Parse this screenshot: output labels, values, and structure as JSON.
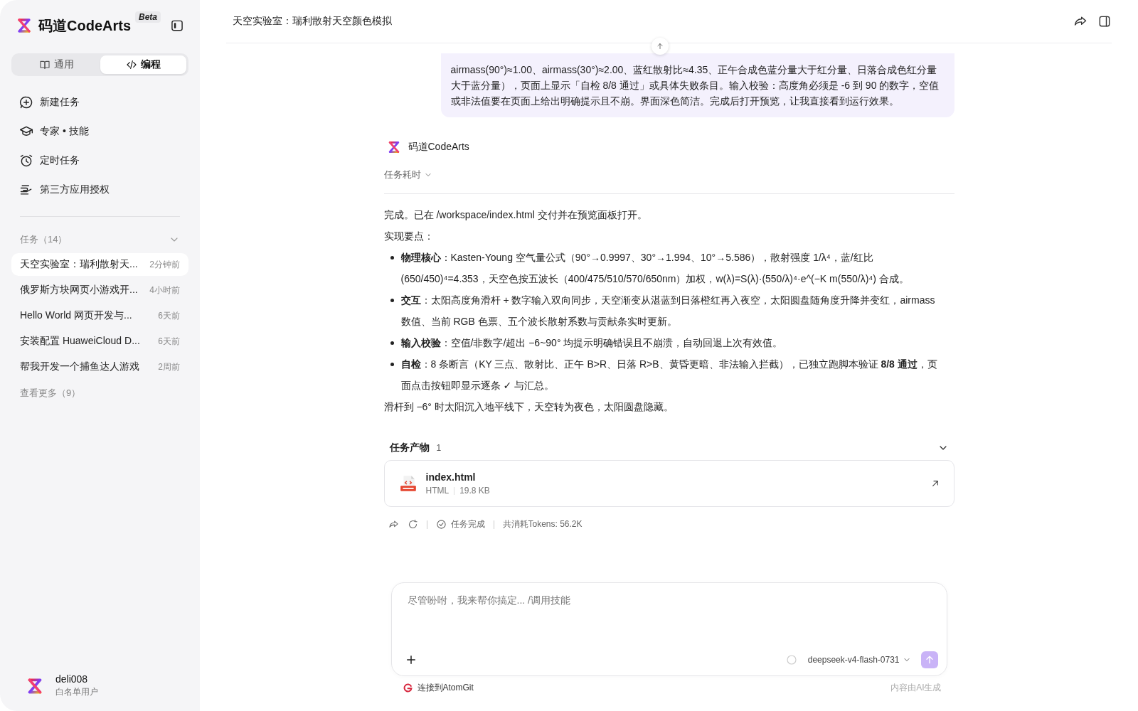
{
  "sidebar": {
    "brand": "码道CodeArts",
    "badge": "Beta",
    "mode_tabs": [
      {
        "label": "通用",
        "selected": false
      },
      {
        "label": "编程",
        "selected": true
      }
    ],
    "nav_items": [
      {
        "label": "新建任务"
      },
      {
        "label": "专家 • 技能"
      },
      {
        "label": "定时任务"
      },
      {
        "label": "第三方应用授权"
      }
    ],
    "tasks": {
      "title": "任务（14）",
      "expanded": true,
      "items": [
        {
          "title": "天空实验室：瑞利散射天...",
          "time": "2分钟前",
          "selected": true
        },
        {
          "title": "俄罗斯方块网页小游戏开...",
          "time": "4小时前",
          "selected": false
        },
        {
          "title": "Hello World 网页开发与...",
          "time": "6天前",
          "selected": false
        },
        {
          "title": "安装配置 HuaweiCloud D...",
          "time": "6天前",
          "selected": false
        },
        {
          "title": "帮我开发一个捕鱼达人游戏",
          "time": "2周前",
          "selected": false
        }
      ]
    },
    "more": "查看更多（9）",
    "user": {
      "name": "deli008",
      "role": "白名单用户"
    }
  },
  "header": {
    "title": "天空实验室：瑞利散射天空颜色模拟"
  },
  "user_message": "airmass(90°)≈1.00、airmass(30°)≈2.00、蓝红散射比≈4.35、正午合成色蓝分量大于红分量、日落合成色红分量大于蓝分量），页面上显示「自检 8/8 通过」或具体失败条目。输入校验：高度角必须是 -6 到 90 的数字，空值或非法值要在页面上给出明确提示且不崩。界面深色简洁。完成后打开预览，让我直接看到运行效果。",
  "assistant": {
    "name": "码道CodeArts",
    "duration_label": "任务耗时",
    "expanded": false,
    "blocks": [
      {
        "kind": "p",
        "text": "完成。已在 /workspace/index.html 交付并在预览面板打开。"
      },
      {
        "kind": "p",
        "text": "实现要点："
      },
      {
        "kind": "li",
        "text": "**物理核心**：Kasten-Young 空气量公式（90°→0.9997、30°→1.994、10°→5.586），散射强度 1/λ⁴，蓝/红比 (650/450)⁴=4.353，天空色按五波长（400/475/510/570/650nm）加权，w(λ)=S(λ)·(550/λ)⁴·e^(−K m(550/λ)⁴) 合成。"
      },
      {
        "kind": "li",
        "text": "**交互**：太阳高度角滑杆 + 数字输入双向同步，天空渐变从湛蓝到日落橙红再入夜空，太阳圆盘随角度升降并变红，airmass 数值、当前 RGB 色票、五个波长散射系数与贡献条实时更新。"
      },
      {
        "kind": "li",
        "text": "**输入校验**：空值/非数字/超出 −6~90° 均提示明确错误且不崩溃，自动回退上次有效值。"
      },
      {
        "kind": "li",
        "text": "**自检**：8 条断言（KY 三点、散射比、正午 B>R、日落 R>B、黄昏更暗、非法输入拦截），已独立跑脚本验证 **8/8 通过**，页面点击按钮即显示逐条 ✓ 与汇总。"
      },
      {
        "kind": "p",
        "text": "滑杆到 −6° 时太阳沉入地平线下，天空转为夜色，太阳圆盘隐藏。"
      }
    ]
  },
  "artifacts": {
    "title": "任务产物",
    "count": "1",
    "expanded": true,
    "files": [
      {
        "name": "index.html",
        "type": "HTML",
        "size": "19.8 KB"
      }
    ]
  },
  "actions": {
    "status": "任务完成",
    "tokens": "共消耗Tokens: 56.2K"
  },
  "composer": {
    "placeholder": "尽管吩咐，我来帮你搞定... /调用技能",
    "model": "deepseek-v4-flash-0731"
  },
  "footer": {
    "connect": "连接到AtomGit",
    "disclaimer": "内容由AI生成"
  }
}
